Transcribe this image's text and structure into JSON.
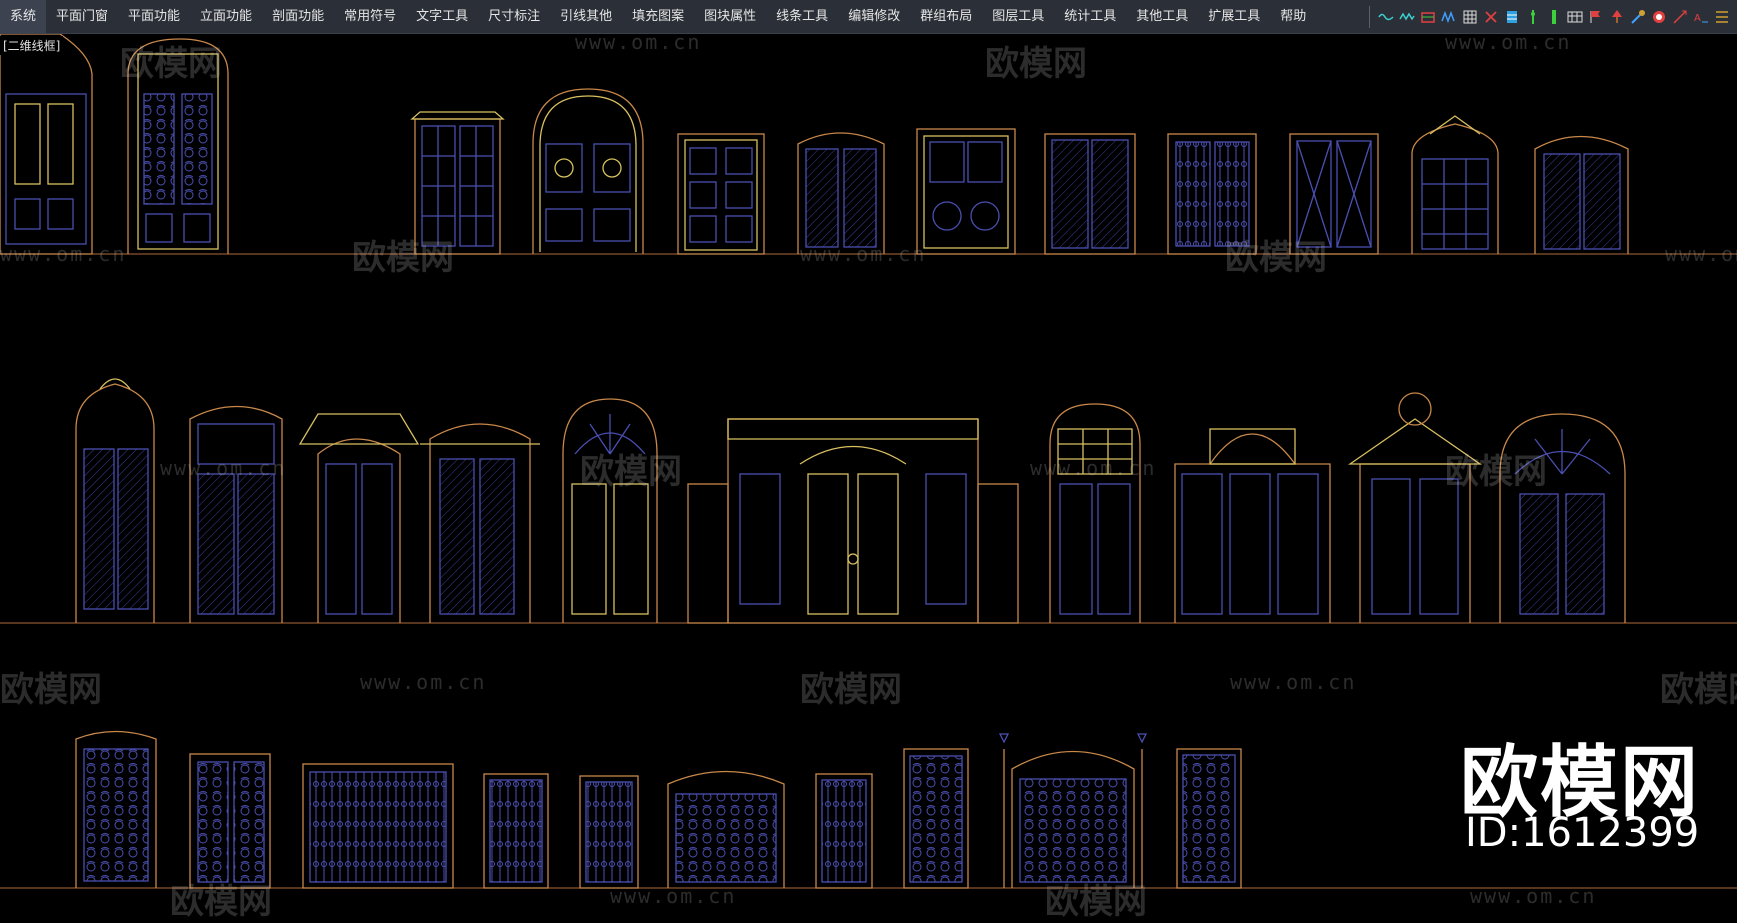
{
  "menubar": {
    "items": [
      "系统",
      "平面门窗",
      "平面功能",
      "立面功能",
      "剖面功能",
      "常用符号",
      "文字工具",
      "尺寸标注",
      "引线其他",
      "填充图案",
      "图块属性",
      "线条工具",
      "编辑修改",
      "群组布局",
      "图层工具",
      "统计工具",
      "其他工具",
      "扩展工具",
      "帮助"
    ]
  },
  "viewport": {
    "label": "[二维线框]"
  },
  "watermarks": {
    "brand": "欧模网",
    "url": "www.om.cn"
  },
  "brand_overlay": {
    "logo": "欧模网",
    "id_text": "ID:1612399"
  },
  "colors": {
    "outline": "#c8884a",
    "inner": "#4a4fb0",
    "yellow": "#d8c060",
    "ground": "#b06a3a"
  }
}
